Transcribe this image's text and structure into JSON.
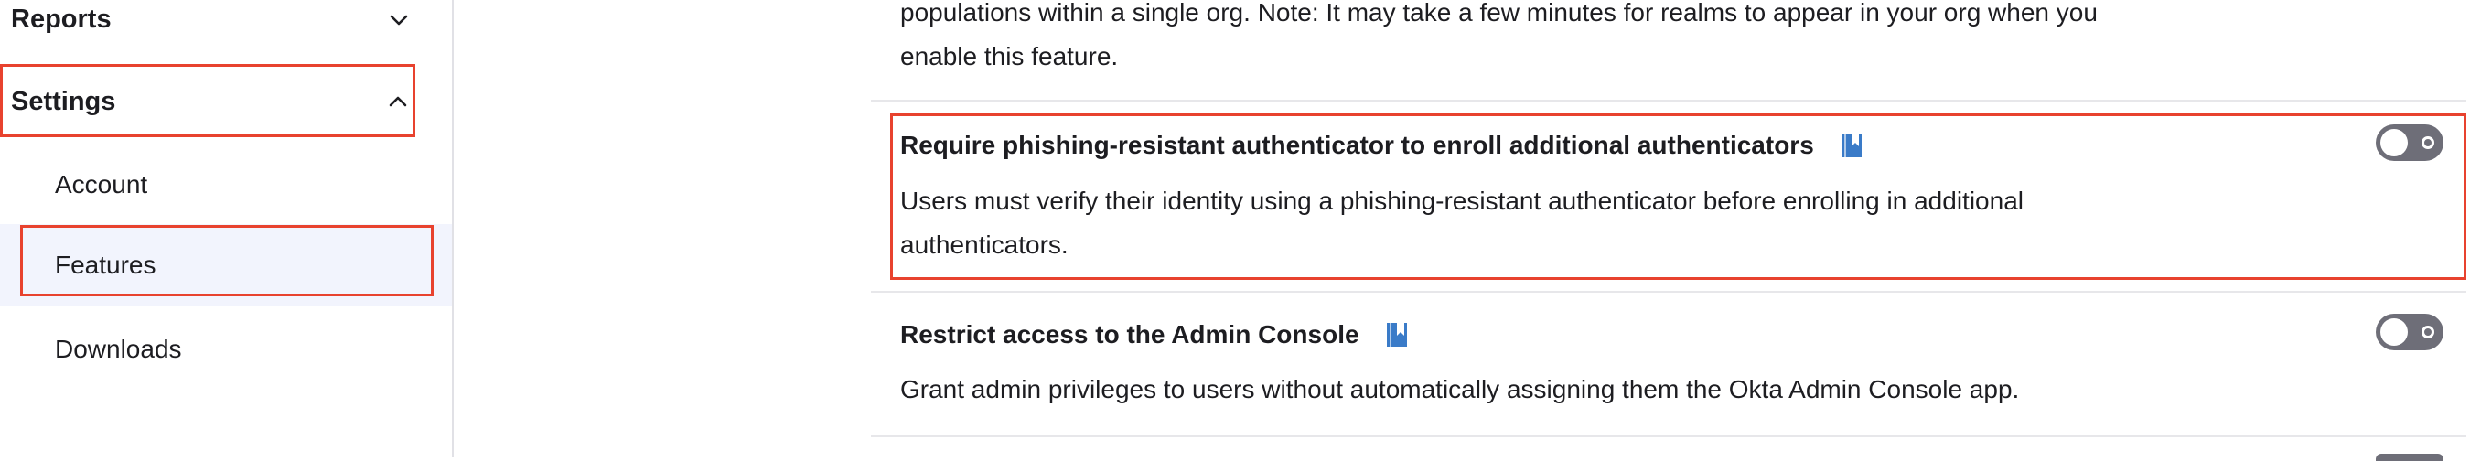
{
  "sidebar": {
    "reports_label": "Reports",
    "settings_label": "Settings",
    "items": [
      {
        "label": "Account"
      },
      {
        "label": "Features"
      },
      {
        "label": "Downloads"
      }
    ]
  },
  "features": {
    "prev_desc_line1": "populations within a single org. Note: It may take a few minutes for realms to appear in your org when you",
    "prev_desc_line2": "enable this feature.",
    "items": [
      {
        "title": "Require phishing-resistant authenticator to enroll additional authenticators",
        "desc_line1": "Users must verify their identity using a phishing-resistant authenticator before enrolling in additional",
        "desc_line2": "authenticators.",
        "enabled": false
      },
      {
        "title": "Restrict access to the Admin Console",
        "desc_line1": "Grant admin privileges to users without automatically assigning them the Okta Admin Console app.",
        "enabled": false
      }
    ]
  },
  "colors": {
    "highlight": "#e8422e",
    "toggle_off": "#6e6e78",
    "doc_icon": "#3a7bc8",
    "selected_bg": "#f2f4fd"
  }
}
